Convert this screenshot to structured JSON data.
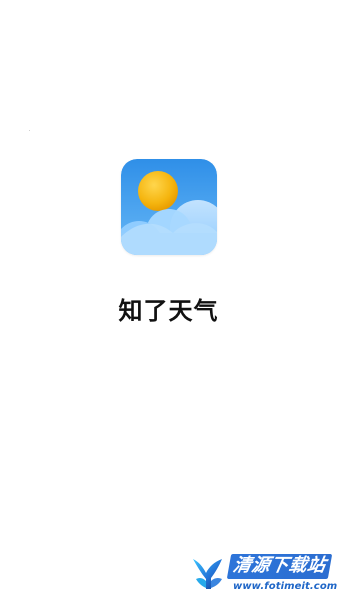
{
  "app": {
    "title": "知了天气"
  },
  "watermark": {
    "title": "清源下载站",
    "url": "www.fotimeit.com"
  },
  "icons": {
    "app_icon": "weather-sun-cloud-icon",
    "watermark_logo": "watermark-logo-icon"
  },
  "colors": {
    "background": "#ffffff",
    "icon_sky": "#4ea8ef",
    "icon_sun": "#f6b80f",
    "watermark_blue": "#2d74d9"
  }
}
